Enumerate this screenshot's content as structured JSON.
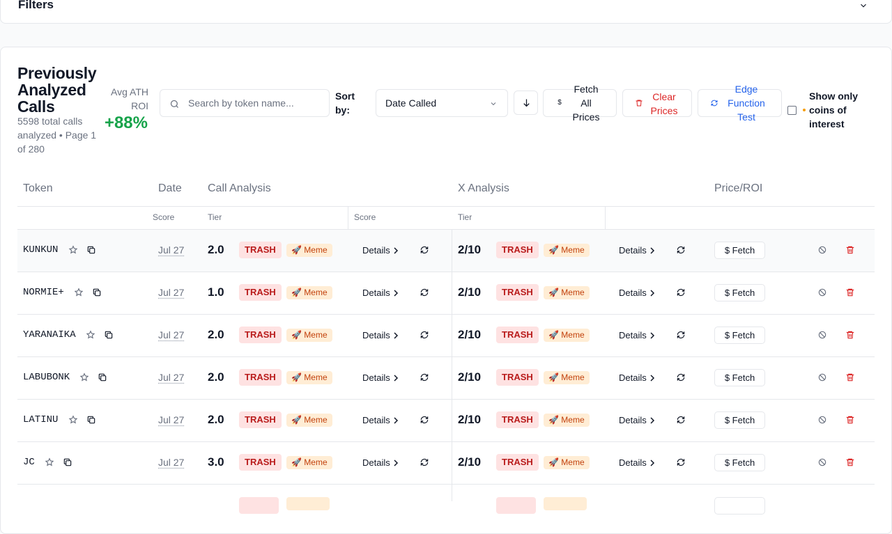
{
  "filters": {
    "title": "Filters"
  },
  "header": {
    "title": "Previously Analyzed Calls",
    "subtitle": "5598 total calls analyzed • Page 1 of 280",
    "avg_label": "Avg ATH ROI",
    "avg_value": "+88%"
  },
  "toolbar": {
    "search_placeholder": "Search by token name...",
    "sort_label": "Sort by:",
    "sort_value": "Date Called",
    "fetch_all": "Fetch All Prices",
    "clear_prices": "Clear Prices",
    "edge_test": "Edge Function Test",
    "interest_label": "Show only coins of interest",
    "fetch_icon": "$"
  },
  "table": {
    "headers": {
      "token": "Token",
      "date": "Date",
      "call": "Call Analysis",
      "x": "X Analysis",
      "price": "Price/ROI"
    },
    "subheaders": {
      "score": "Score",
      "tier": "Tier",
      "xscore": "Score",
      "xtier": "Tier"
    },
    "rows": [
      {
        "token": "KUNKUN",
        "date": "Jul 27",
        "score": "2.0",
        "tier": "TRASH",
        "tag": "Meme",
        "details": "Details",
        "xscore": "2/10",
        "xtier": "TRASH",
        "xtag": "Meme",
        "xdetails": "Details",
        "fetch": "Fetch"
      },
      {
        "token": "NORMIE+",
        "date": "Jul 27",
        "score": "1.0",
        "tier": "TRASH",
        "tag": "Meme",
        "details": "Details",
        "xscore": "2/10",
        "xtier": "TRASH",
        "xtag": "Meme",
        "xdetails": "Details",
        "fetch": "Fetch"
      },
      {
        "token": "YARANAIKA",
        "date": "Jul 27",
        "score": "2.0",
        "tier": "TRASH",
        "tag": "Meme",
        "details": "Details",
        "xscore": "2/10",
        "xtier": "TRASH",
        "xtag": "Meme",
        "xdetails": "Details",
        "fetch": "Fetch"
      },
      {
        "token": "LABUBONK",
        "date": "Jul 27",
        "score": "2.0",
        "tier": "TRASH",
        "tag": "Meme",
        "details": "Details",
        "xscore": "2/10",
        "xtier": "TRASH",
        "xtag": "Meme",
        "xdetails": "Details",
        "fetch": "Fetch"
      },
      {
        "token": "LATINU",
        "date": "Jul 27",
        "score": "2.0",
        "tier": "TRASH",
        "tag": "Meme",
        "details": "Details",
        "xscore": "2/10",
        "xtier": "TRASH",
        "xtag": "Meme",
        "xdetails": "Details",
        "fetch": "Fetch"
      },
      {
        "token": "JC",
        "date": "Jul 27",
        "score": "3.0",
        "tier": "TRASH",
        "tag": "Meme",
        "details": "Details",
        "xscore": "2/10",
        "xtier": "TRASH",
        "xtag": "Meme",
        "xdetails": "Details",
        "fetch": "Fetch"
      }
    ]
  }
}
